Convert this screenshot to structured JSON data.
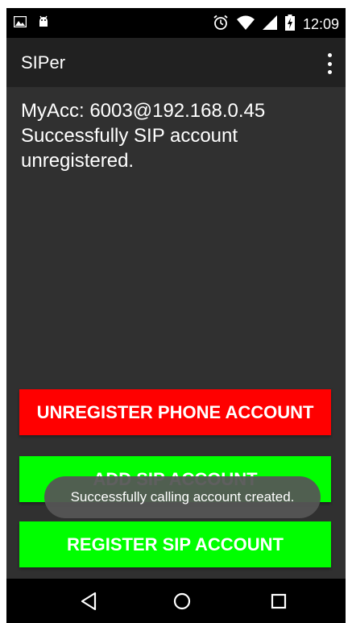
{
  "status_bar": {
    "time": "12:09",
    "icons": [
      "image-notification-icon",
      "android-notification-icon",
      "alarm-icon",
      "wifi-icon",
      "cell-signal-icon",
      "battery-charging-icon"
    ]
  },
  "app_bar": {
    "title": "SIPer",
    "menu_icon": "overflow-menu-icon"
  },
  "main": {
    "account_line": "MyAcc: 6003@192.168.0.45",
    "status_line_1": "Successfully SIP account",
    "status_line_2": "unregistered."
  },
  "buttons": {
    "unregister_label": "UNREGISTER PHONE ACCOUNT",
    "add_label": "ADD SIP ACCOUNT",
    "register_label": "REGISTER SIP ACCOUNT"
  },
  "toast": {
    "message": "Successfully calling account created."
  },
  "nav_bar": {
    "icons": [
      "back-icon",
      "home-icon",
      "recents-icon"
    ]
  },
  "colors": {
    "background": "#303030",
    "app_bar": "#212121",
    "unregister_button": "#ff0000",
    "sip_buttons": "#00ff00",
    "toast": "#555555"
  }
}
